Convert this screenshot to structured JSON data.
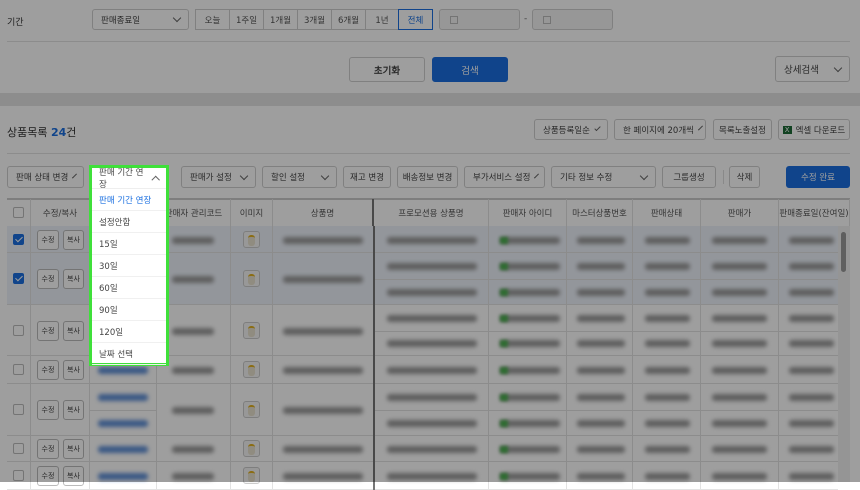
{
  "search": {
    "period_label": "기간",
    "date_type": "판매종료일",
    "ranges": [
      "오늘",
      "1주일",
      "1개월",
      "3개월",
      "6개월",
      "1년",
      "전체"
    ],
    "active_range": "전체",
    "date_sep": "-",
    "reset": "초기화",
    "search": "검색",
    "detail": "상세검색"
  },
  "list": {
    "title": "상품목록",
    "count": "24",
    "count_unit": "건",
    "sort": "상품등록일순",
    "page_size": "한 페이지에 20개씩",
    "display_settings": "목록노출설정",
    "excel": "엑셀 다운로드",
    "excel_icon": "X"
  },
  "actions": {
    "status": "판매 상태 변경",
    "period": "판매 기간 연장",
    "price": "판매가 설정",
    "discount": "할인 설정",
    "stock": "재고 변경",
    "shipping": "배송정보 변경",
    "addon": "부가서비스 설정",
    "etc": "기타 정보 수정",
    "group": "그룹생성",
    "delete": "삭제",
    "done": "수정 완료"
  },
  "dropdown": {
    "label": "판매 기간 연장",
    "options": [
      "판매 기간 연장",
      "설정안함",
      "15일",
      "30일",
      "60일",
      "90일",
      "120일",
      "날짜 선택"
    ],
    "selected": "판매 기간 연장"
  },
  "table": {
    "headers": [
      "수정/복사",
      "판매자 관리코드",
      "이미지",
      "상품명",
      "프로모션용 상품명",
      "판매자 아이디",
      "마스터상품번호",
      "판매상태",
      "판매가",
      "판매종료일(잔여일)"
    ],
    "edit": "수정",
    "copy": "복사",
    "rows": [
      {
        "checked": true
      },
      {
        "checked": true
      },
      {
        "checked": false
      },
      {
        "checked": false
      },
      {
        "checked": false
      },
      {
        "checked": false
      },
      {
        "checked": false
      }
    ]
  },
  "colors": {
    "accent": "#1a6fe0",
    "highlight": "#3fe03a"
  }
}
